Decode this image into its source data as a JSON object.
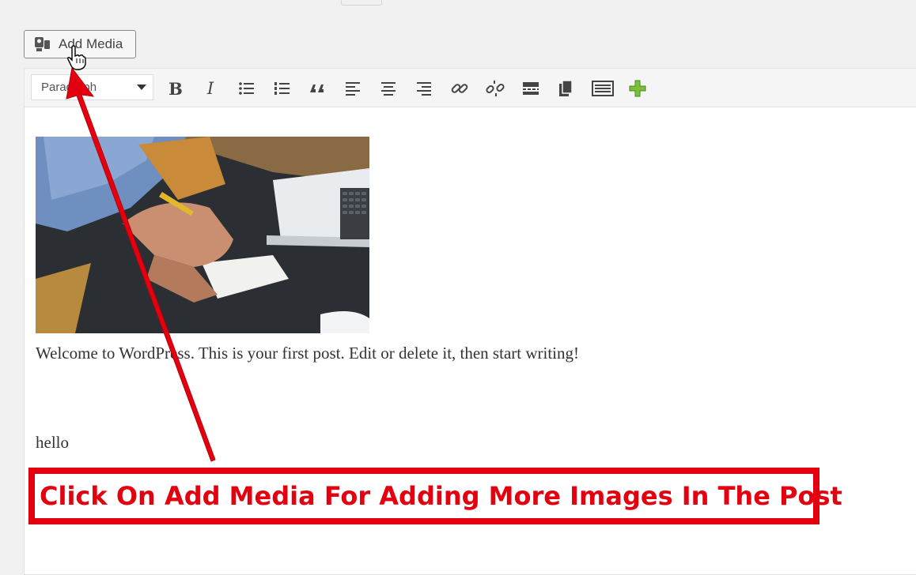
{
  "add_media": {
    "label": "Add Media",
    "icon": "media-camera-icon"
  },
  "toolbar": {
    "format_select": "Paragraph",
    "buttons": [
      {
        "name": "bold",
        "icon": "bold-icon",
        "label": "B"
      },
      {
        "name": "italic",
        "icon": "italic-icon",
        "label": "I"
      },
      {
        "name": "bullet-list",
        "icon": "bullet-list-icon"
      },
      {
        "name": "numbered-list",
        "icon": "numbered-list-icon"
      },
      {
        "name": "blockquote",
        "icon": "quote-icon"
      },
      {
        "name": "align-left",
        "icon": "align-left-icon"
      },
      {
        "name": "align-center",
        "icon": "align-center-icon"
      },
      {
        "name": "align-right",
        "icon": "align-right-icon"
      },
      {
        "name": "insert-link",
        "icon": "link-icon"
      },
      {
        "name": "remove-link",
        "icon": "unlink-icon"
      },
      {
        "name": "read-more",
        "icon": "read-more-icon"
      },
      {
        "name": "paste",
        "icon": "copy-icon"
      },
      {
        "name": "toolbar-toggle",
        "icon": "keyboard-icon"
      },
      {
        "name": "add-block",
        "icon": "plus-icon"
      }
    ]
  },
  "content": {
    "image_alt": "person writing at desk with laptop",
    "paragraph": "Welcome to WordPress. This is your first post. Edit or delete it, then start writing!",
    "second_paragraph": "hello"
  },
  "annotation": {
    "caption": "Click On Add Media For Adding More Images In The Post",
    "color": "#e3000f"
  }
}
